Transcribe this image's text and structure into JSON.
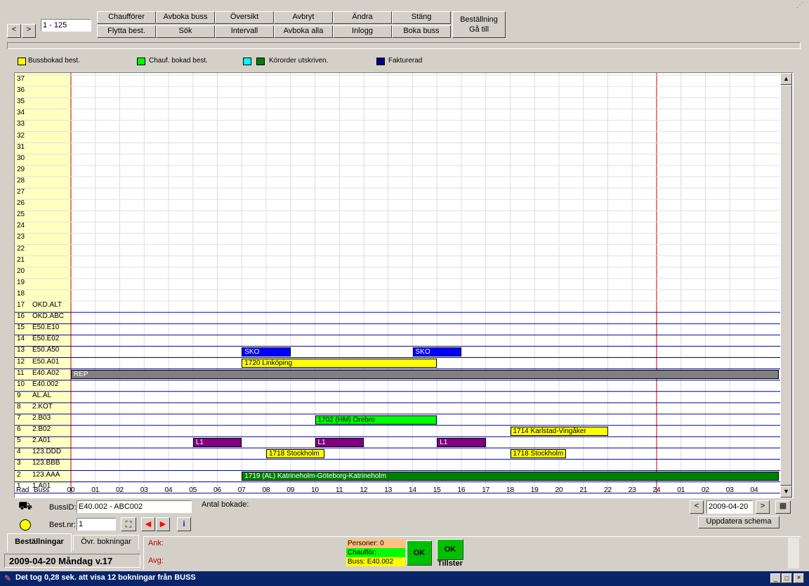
{
  "toolbar": {
    "range_value": "1 - 125",
    "buttons_top": [
      "Chaufförer",
      "Avboka buss",
      "Översikt",
      "Avbryt",
      "Ändra",
      "Stäng"
    ],
    "buttons_bottom": [
      "Flytta best.",
      "Sök",
      "Intervall",
      "Avboka alla",
      "Inlogg",
      "Boka buss"
    ],
    "bestallning_label": "Beställning",
    "ga_till_label": "Gå till"
  },
  "legend": {
    "items": [
      {
        "label": "Bussbokad best.",
        "color": "#ffff00"
      },
      {
        "label": "Chauf. bokad best.",
        "color": "#00ff00"
      },
      {
        "label": "Körorder utskriven.",
        "color": "#00ffff",
        "color2": "#008000"
      },
      {
        "label": "Fakturerad",
        "color": "#000080"
      }
    ]
  },
  "grid": {
    "header_rad": "Rad",
    "header_buss": "Buss",
    "hours": [
      "00",
      "01",
      "02",
      "03",
      "04",
      "05",
      "06",
      "07",
      "08",
      "09",
      "10",
      "11",
      "12",
      "13",
      "14",
      "15",
      "16",
      "17",
      "18",
      "19",
      "20",
      "21",
      "22",
      "23",
      "24",
      "01",
      "02",
      "03",
      "04"
    ],
    "rows": [
      {
        "num": "37",
        "bus": ""
      },
      {
        "num": "36",
        "bus": ""
      },
      {
        "num": "35",
        "bus": ""
      },
      {
        "num": "34",
        "bus": ""
      },
      {
        "num": "33",
        "bus": ""
      },
      {
        "num": "32",
        "bus": ""
      },
      {
        "num": "31",
        "bus": ""
      },
      {
        "num": "30",
        "bus": ""
      },
      {
        "num": "29",
        "bus": ""
      },
      {
        "num": "28",
        "bus": ""
      },
      {
        "num": "27",
        "bus": ""
      },
      {
        "num": "26",
        "bus": ""
      },
      {
        "num": "25",
        "bus": ""
      },
      {
        "num": "24",
        "bus": ""
      },
      {
        "num": "23",
        "bus": ""
      },
      {
        "num": "22",
        "bus": ""
      },
      {
        "num": "21",
        "bus": ""
      },
      {
        "num": "20",
        "bus": ""
      },
      {
        "num": "19",
        "bus": ""
      },
      {
        "num": "18",
        "bus": ""
      },
      {
        "num": "17",
        "bus": "OKD.ALT"
      },
      {
        "num": "16",
        "bus": "OKD.ABC"
      },
      {
        "num": "15",
        "bus": "E50.E10"
      },
      {
        "num": "14",
        "bus": "E50.E02"
      },
      {
        "num": "13",
        "bus": "E50.A50"
      },
      {
        "num": "12",
        "bus": "E50.A01"
      },
      {
        "num": "11",
        "bus": "E40.A02"
      },
      {
        "num": "10",
        "bus": "E40.002"
      },
      {
        "num": "9",
        "bus": "AL.AL"
      },
      {
        "num": "8",
        "bus": "2.KOT"
      },
      {
        "num": "7",
        "bus": "2.B03"
      },
      {
        "num": "6",
        "bus": "2.B02"
      },
      {
        "num": "5",
        "bus": "2.A01"
      },
      {
        "num": "4",
        "bus": "123.DDD"
      },
      {
        "num": "3",
        "bus": "123.BBB"
      },
      {
        "num": "2",
        "bus": "123.AAA"
      },
      {
        "num": "1",
        "bus": "1.A01"
      }
    ],
    "bookings": [
      {
        "row": 13,
        "start": 7.0,
        "end": 9.0,
        "label": "SKO",
        "color": "#0000ff",
        "text": "#ffffff"
      },
      {
        "row": 13,
        "start": 14.0,
        "end": 16.0,
        "label": "SKO",
        "color": "#0000ff",
        "text": "#ffffff"
      },
      {
        "row": 12,
        "start": 7.0,
        "end": 15.0,
        "label": "1720 Linköping",
        "color": "#ffff00",
        "text": "#000000"
      },
      {
        "row": 11,
        "start": 0.0,
        "end": 29.0,
        "label": "REP",
        "color": "#808080",
        "text": "#ffffff"
      },
      {
        "row": 7,
        "start": 10.0,
        "end": 15.0,
        "label": "1702 (HM) Örebro",
        "color": "#00ff00",
        "text": "#000000"
      },
      {
        "row": 6,
        "start": 18.0,
        "end": 22.0,
        "label": "1714 Karlstad-Vingåker",
        "color": "#ffff00",
        "text": "#000000"
      },
      {
        "row": 5,
        "start": 5.0,
        "end": 7.0,
        "label": "L1",
        "color": "#800080",
        "text": "#ffffff"
      },
      {
        "row": 5,
        "start": 10.0,
        "end": 12.0,
        "label": "L1",
        "color": "#800080",
        "text": "#ffffff"
      },
      {
        "row": 5,
        "start": 15.0,
        "end": 17.0,
        "label": "L1",
        "color": "#800080",
        "text": "#ffffff"
      },
      {
        "row": 4,
        "start": 8.0,
        "end": 10.4,
        "label": "1718 Stockholm",
        "color": "#ffff00",
        "text": "#000000"
      },
      {
        "row": 4,
        "start": 18.0,
        "end": 20.3,
        "label": "1718 Stockholm",
        "color": "#ffff00",
        "text": "#000000"
      },
      {
        "row": 2,
        "start": 7.0,
        "end": 29.0,
        "label": "1719 (AL) Katrineholm-Göteborg-Katrineholm",
        "color": "#008000",
        "text": "#ffffff"
      }
    ]
  },
  "bottom": {
    "bussid_label": "BussID:",
    "bussid_value": "E40.002   - ABC002",
    "antal_label": "Antal bokade:",
    "bestnr_label": "Best.nr:",
    "bestnr_value": "1",
    "date_value": "2009-04-20",
    "uppdatera_label": "Uppdatera schema",
    "tab_bestallningar": "Beställningar",
    "tab_ovr": "Övr. bokningar",
    "ank_label": "Ank:",
    "avg_label": "Avg:",
    "personer_label": "Personer: 0",
    "chauffor_label": "Chaufför:",
    "buss_label": "Buss: E40.002",
    "ok_label": "OK",
    "tillster_label": "Tillster",
    "day_label": "2009-04-20 Måndag v.17"
  },
  "statusbar": {
    "text": "Det tog 0,28 sek. att visa 12 bokningar från BUSS"
  }
}
